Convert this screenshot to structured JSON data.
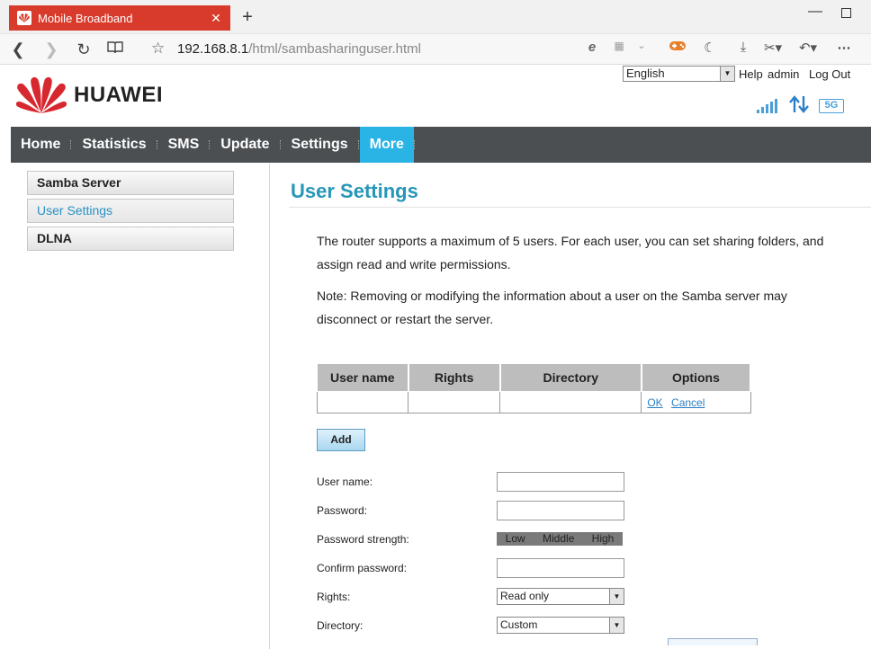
{
  "browser": {
    "tab_title": "Mobile Broadband",
    "tab_close": "✕",
    "new_tab": "+",
    "url_host": "192.168.8.1",
    "url_path": "/html/sambasharinguser.html",
    "icons": [
      "back-icon",
      "forward-icon",
      "refresh-icon",
      "reading-view-icon",
      "favorite-star-icon",
      "edge-icon",
      "qr-code-icon",
      "chevron-down-icon",
      "game-icon",
      "moon-icon",
      "download-icon",
      "scissors-icon",
      "undo-icon",
      "more-icon"
    ]
  },
  "header": {
    "brand": "HUAWEI",
    "language": "English",
    "help": "Help",
    "user": "admin",
    "logout": "Log Out",
    "network_badge": "5G"
  },
  "nav": {
    "items": [
      {
        "label": "Home"
      },
      {
        "label": "Statistics"
      },
      {
        "label": "SMS"
      },
      {
        "label": "Update"
      },
      {
        "label": "Settings"
      },
      {
        "label": "More"
      }
    ],
    "active": "More"
  },
  "sidebar": {
    "items": [
      {
        "label": "Samba Server"
      },
      {
        "label": "User Settings"
      },
      {
        "label": "DLNA"
      }
    ],
    "selected": "User Settings"
  },
  "main": {
    "title": "User Settings",
    "intro": "The router supports a maximum of 5 users. For each user, you can set sharing folders, and assign read and write permissions.",
    "note": "Note: Removing or modifying the information about a user on the Samba server may disconnect or restart the server.",
    "table": {
      "headers": [
        "User name",
        "Rights",
        "Directory",
        "Options"
      ],
      "row_actions": {
        "ok": "OK",
        "cancel": "Cancel"
      }
    },
    "add_button": "Add",
    "form": {
      "username_label": "User name:",
      "password_label": "Password:",
      "strength_label": "Password strength:",
      "strength_levels": [
        "Low",
        "Middle",
        "High"
      ],
      "confirm_label": "Confirm password:",
      "rights_label": "Rights:",
      "rights_value": "Read only",
      "directory_label": "Directory:",
      "directory_value": "Custom"
    }
  },
  "colors": {
    "tab_red": "#d83b2b",
    "nav_bg": "#4b4f52",
    "nav_active": "#2ab4e6",
    "title_blue": "#2796b8",
    "link_blue": "#2a7fc4"
  }
}
